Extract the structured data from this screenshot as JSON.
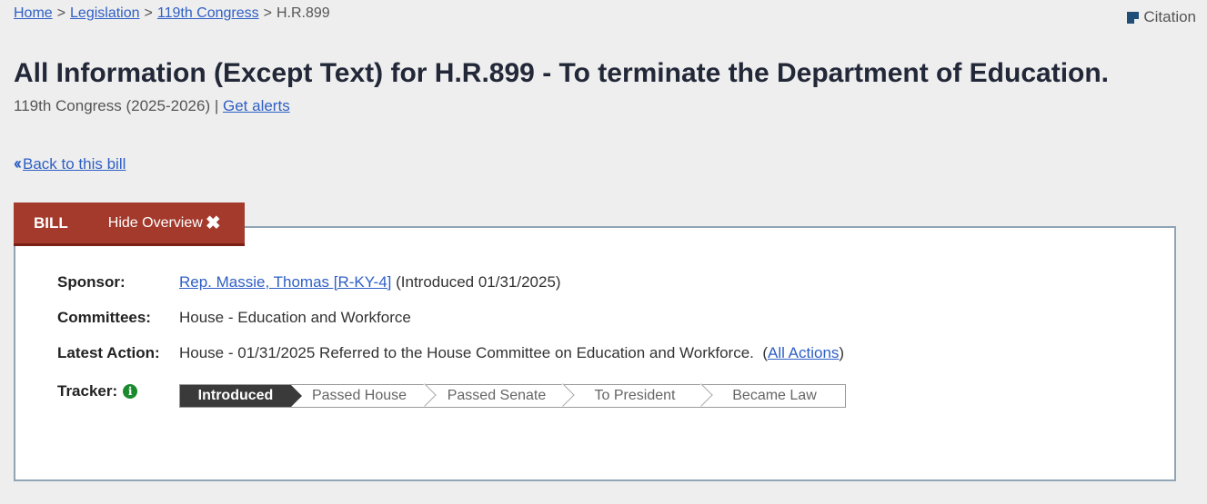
{
  "breadcrumb": {
    "home": "Home",
    "legislation": "Legislation",
    "congress": "119th Congress",
    "current": "H.R.899",
    "sep": ">"
  },
  "citation": {
    "label": "Citation"
  },
  "page": {
    "title": "All Information (Except Text) for H.R.899 - To terminate the Department of Education.",
    "congress": "119th Congress (2025-2026)",
    "divider": "|",
    "alerts_link": "Get alerts",
    "back_link": "Back to this bill"
  },
  "tabs": {
    "bill": "BILL",
    "hide_overview": "Hide Overview"
  },
  "overview": {
    "sponsor_label": "Sponsor:",
    "sponsor_name": "Rep. Massie, Thomas [R-KY-4]",
    "sponsor_intro": "(Introduced 01/31/2025)",
    "committees_label": "Committees:",
    "committees_value": "House - Education and Workforce",
    "latest_action_label": "Latest Action:",
    "latest_action_value": "House - 01/31/2025 Referred to the House Committee on Education and Workforce.",
    "all_actions_link": "All Actions",
    "tracker_label": "Tracker:",
    "tracker_steps": [
      "Introduced",
      "Passed House",
      "Passed Senate",
      "To President",
      "Became Law"
    ],
    "tracker_current": "Introduced"
  },
  "colors": {
    "tab_bg": "#a33a2c",
    "link": "#2f5fc5",
    "info_icon": "#1a8a2e",
    "tracker_active": "#3a3a3a"
  }
}
